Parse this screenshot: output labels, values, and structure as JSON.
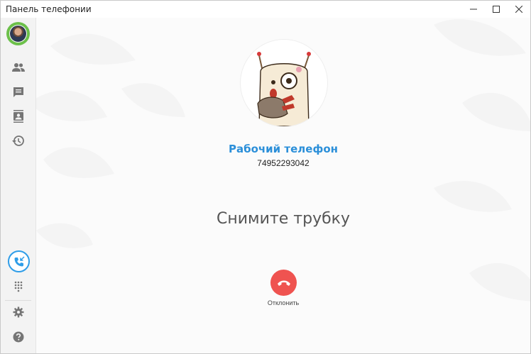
{
  "window": {
    "title": "Панель телефонии",
    "minimize_icon": "minimize-icon",
    "maximize_icon": "maximize-icon",
    "close_icon": "close-icon"
  },
  "sidebar": {
    "avatar_status_color": "#6cc04a",
    "items": [
      {
        "name": "contacts",
        "icon": "people-icon"
      },
      {
        "name": "chats",
        "icon": "chat-icon"
      },
      {
        "name": "address-book",
        "icon": "contact-card-icon"
      },
      {
        "name": "history",
        "icon": "history-icon"
      }
    ],
    "bottom_items": [
      {
        "name": "incoming-call",
        "icon": "incoming-call-icon",
        "active_color": "#2f9de8"
      },
      {
        "name": "dialpad",
        "icon": "dialpad-icon"
      },
      {
        "name": "settings",
        "icon": "gear-icon"
      },
      {
        "name": "help",
        "icon": "help-icon"
      }
    ]
  },
  "call": {
    "contact_name": "Рабочий телефон",
    "phone_number": "74952293042",
    "status": "Снимите трубку",
    "decline_label": "Отклонить",
    "decline_color": "#ef5350"
  }
}
